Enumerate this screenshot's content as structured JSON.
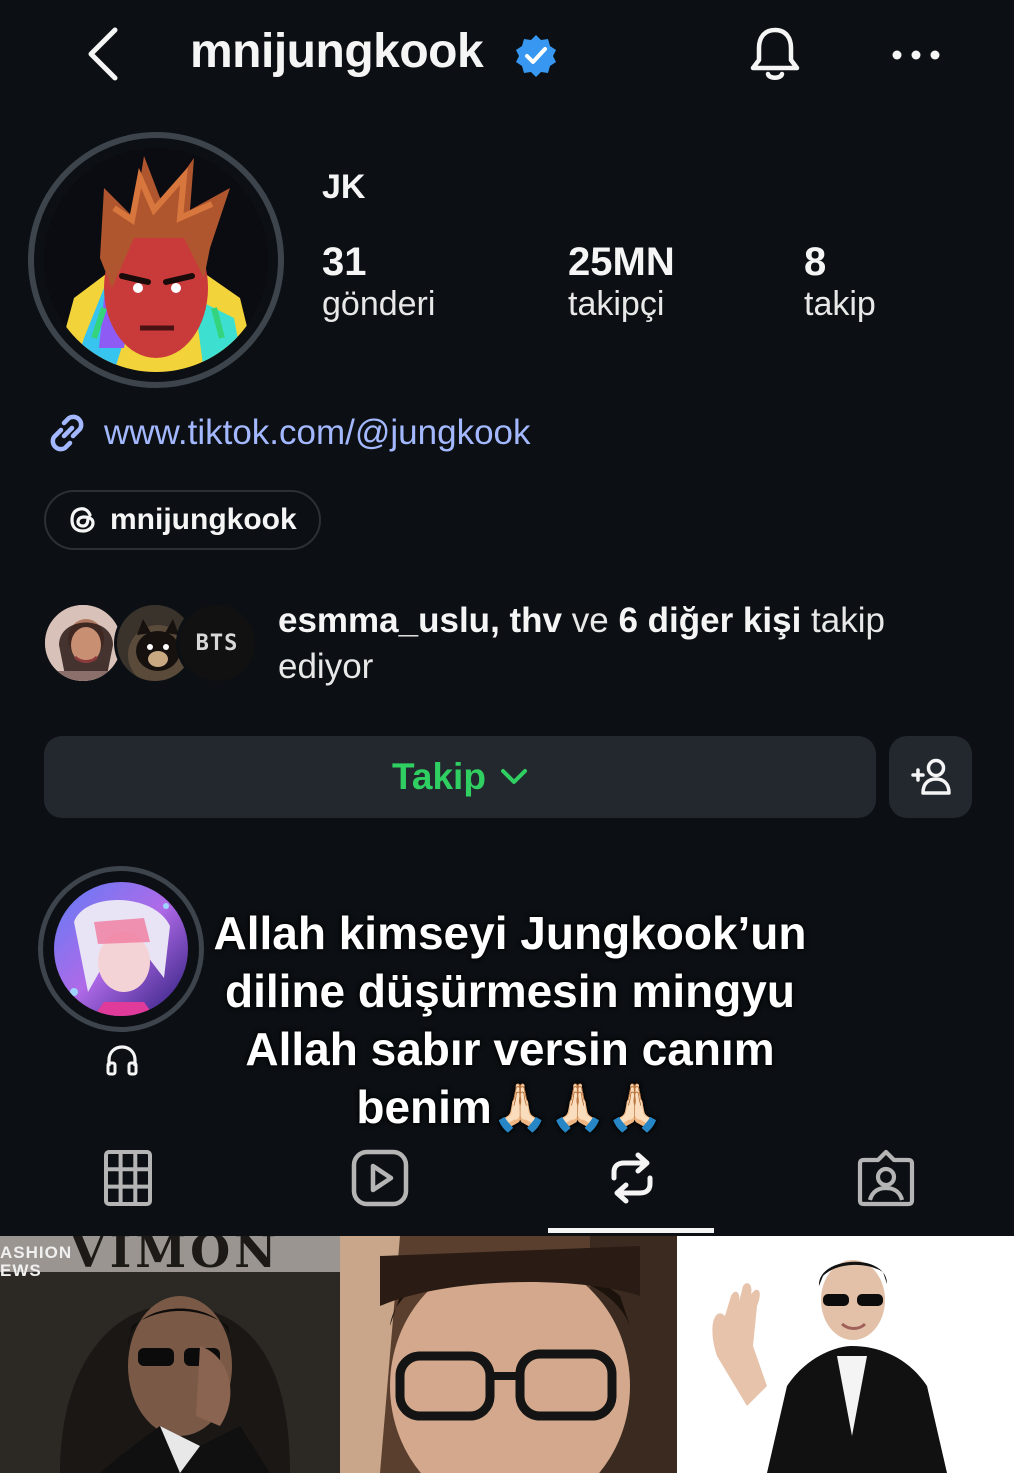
{
  "header": {
    "username": "mnijungkook",
    "icons": {
      "back": "chevron-left-icon",
      "verified": "verified-badge-icon",
      "notifications": "bell-icon",
      "more": "more-icon"
    }
  },
  "profile": {
    "display_name": "JK",
    "stats": [
      {
        "value": "31",
        "label": "gönderi"
      },
      {
        "value": "25MN",
        "label": "takipçi"
      },
      {
        "value": "8",
        "label": "takip"
      }
    ],
    "link": "www.tiktok.com/@jungkook",
    "threads_handle": "mnijungkook",
    "mutual": {
      "name1": "esmma_uslu",
      "sep1": ", ",
      "name2": "thv",
      "mid": " ve ",
      "others": "6 diğer kişi",
      "suffix": " takip ediyor",
      "avatar3_text": "BTS"
    }
  },
  "actions": {
    "follow_label": "Takip"
  },
  "overlay_caption": "Allah kimseyi Jungkook’un diline düşürmesin mingyu Allah sabır versin canım benim🙏🏻🙏🏻🙏🏻",
  "tabs": [
    "grid-icon",
    "reels-icon",
    "reposts-icon",
    "tagged-icon"
  ],
  "grid": {
    "thumb1_text": "ASHION\nEWS",
    "thumb1_bg_text": "VIMON"
  },
  "colors": {
    "background": "#0c1014",
    "link": "#a3b8ff",
    "follow_text": "#2fcf61",
    "verified": "#3897f0",
    "button_bg": "#23282e"
  }
}
